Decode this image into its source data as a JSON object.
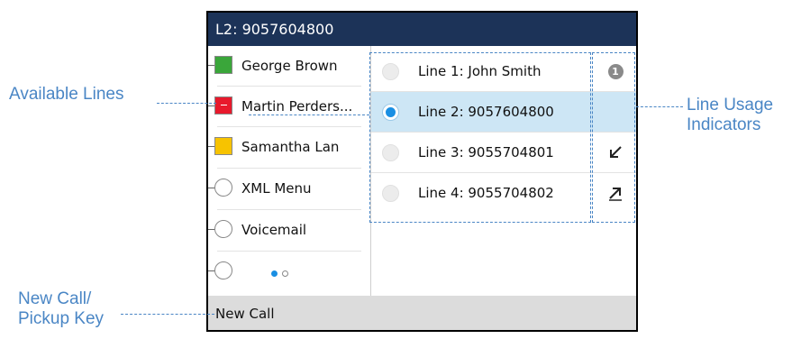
{
  "header": {
    "title": "L2: 9057604800"
  },
  "callouts": {
    "available_lines": "Available Lines",
    "line_usage_1": "Line Usage",
    "line_usage_2": "Indicators",
    "new_call_1": "New Call/",
    "new_call_2": "Pickup Key"
  },
  "programmable_keys": [
    {
      "label": "George Brown",
      "type": "blf",
      "status_color": "#3aa63a"
    },
    {
      "label": "Martin Perders...",
      "type": "blf",
      "status_color": "#e8192c"
    },
    {
      "label": "Samantha Lan",
      "type": "blf",
      "status_color": "#f7c300"
    },
    {
      "label": "XML Menu",
      "type": "empty"
    },
    {
      "label": "Voicemail",
      "type": "empty"
    },
    {
      "label": "",
      "type": "empty"
    }
  ],
  "page_indicator": {
    "current": 1,
    "total": 2
  },
  "lines": [
    {
      "label": "Line 1: John Smith",
      "selected": false,
      "indicator": "count-badge",
      "indicator_text": "1"
    },
    {
      "label": "Line 2: 9057604800",
      "selected": true,
      "indicator": "none"
    },
    {
      "label": "Line 3: 9055704801",
      "selected": false,
      "indicator": "incoming-arrow-icon"
    },
    {
      "label": "Line 4: 9055704802",
      "selected": false,
      "indicator": "outgoing-arrow-icon"
    }
  ],
  "softkeys": {
    "new_call": "New Call"
  },
  "colors": {
    "header_bg": "#1c3358",
    "selected_row": "#cde6f5",
    "accent": "#1a8fe3",
    "callout": "#4a86c5",
    "softkey_bar": "#dcdcdc"
  }
}
